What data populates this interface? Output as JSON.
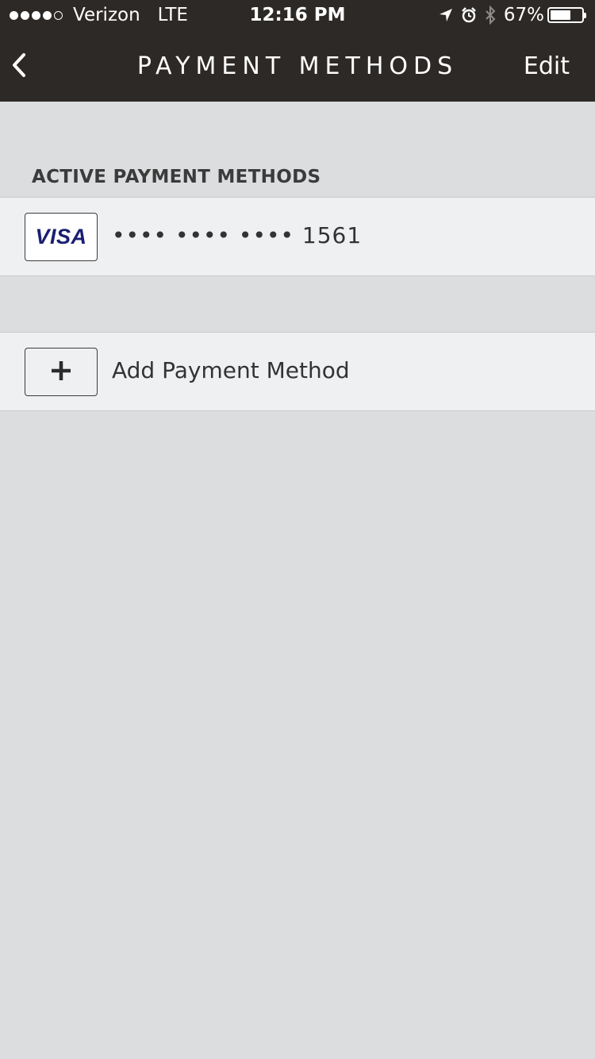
{
  "status_bar": {
    "carrier": "Verizon",
    "network": "LTE",
    "time": "12:16 PM",
    "battery_percent": "67%",
    "battery_level": 0.67,
    "signal_bars_filled": 4,
    "signal_bars_total": 5,
    "icons": [
      "location-arrow-icon",
      "alarm-clock-icon",
      "bluetooth-icon",
      "battery-icon"
    ]
  },
  "nav": {
    "title": "PAYMENT METHODS",
    "edit_label": "Edit",
    "back_icon": "chevron-left-icon"
  },
  "section": {
    "header": "ACTIVE PAYMENT METHODS"
  },
  "cards": [
    {
      "brand": "VISA",
      "masked_number": "•••• •••• •••• 1561"
    }
  ],
  "add_method": {
    "label": "Add Payment Method",
    "icon": "plus-icon"
  },
  "colors": {
    "header_bg": "#2d2926",
    "page_bg": "#dcdddf",
    "row_bg": "#eff0f2",
    "visa_blue": "#1a1f71"
  }
}
